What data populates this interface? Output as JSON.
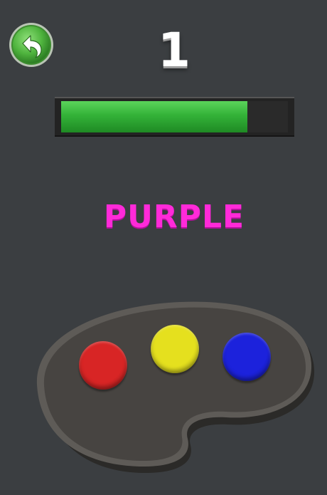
{
  "hud": {
    "score": "1",
    "progress": 0.82
  },
  "prompt": {
    "word": "PURPLE",
    "word_color": "#ff2ad9"
  },
  "palette": {
    "paints": [
      {
        "name": "red",
        "color": "#d82525"
      },
      {
        "name": "yellow",
        "color": "#e5e01e"
      },
      {
        "name": "blue",
        "color": "#1c22dc"
      }
    ]
  },
  "icons": {
    "back": "undo-arrow-icon"
  }
}
